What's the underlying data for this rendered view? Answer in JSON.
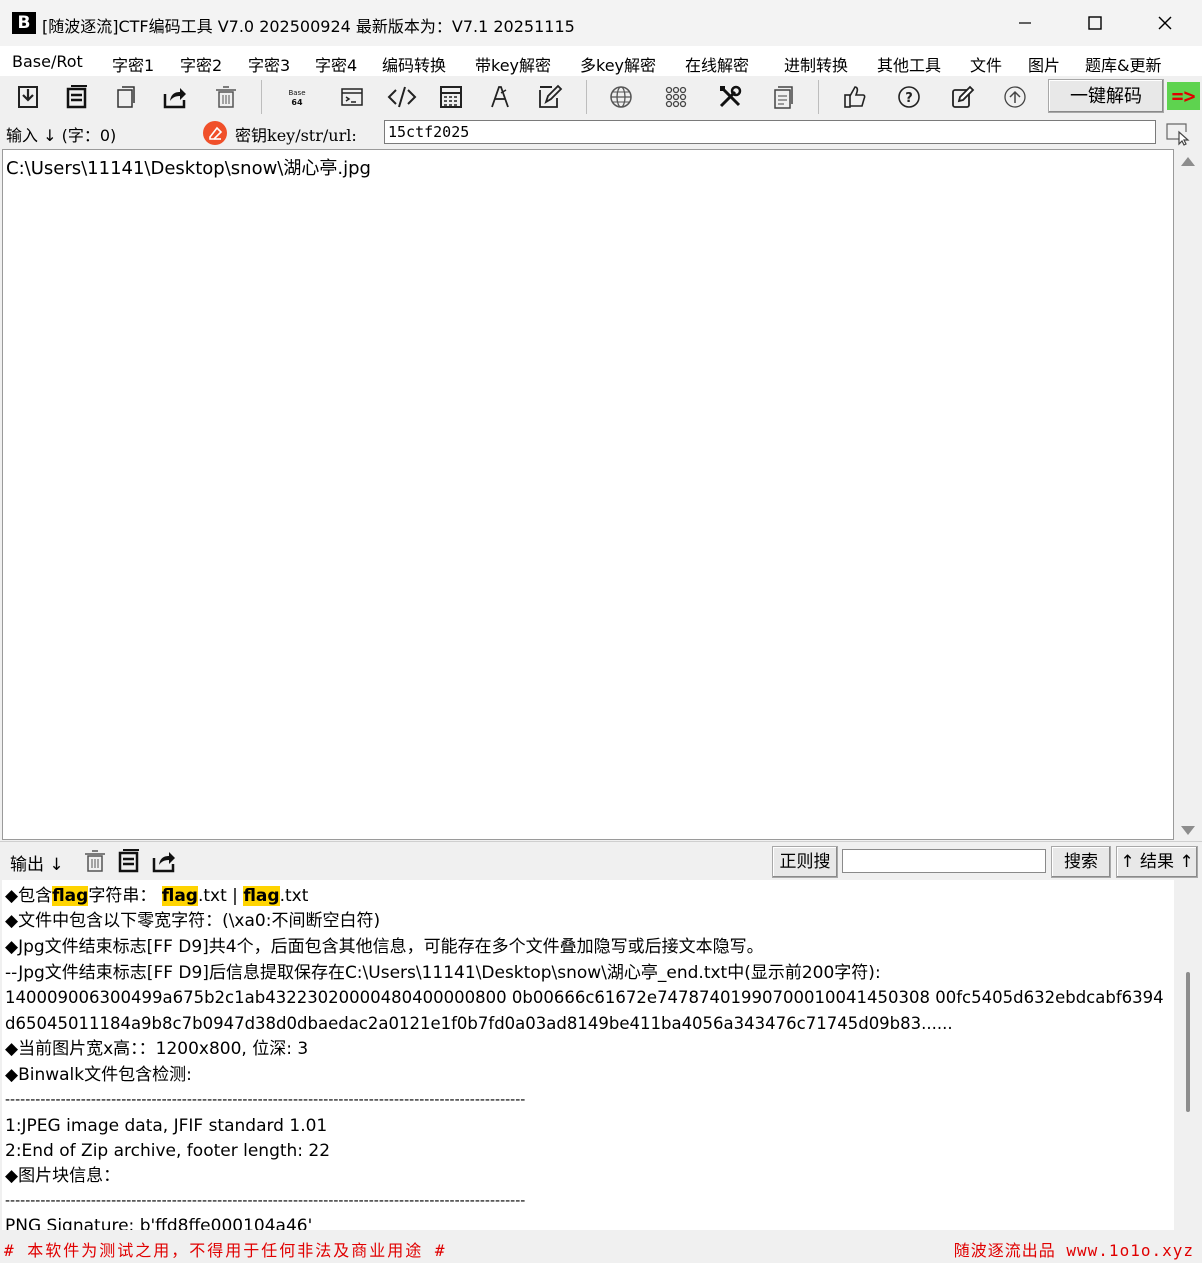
{
  "window": {
    "logo_text": "B",
    "title": "[随波逐流]CTF编码工具 V7.0 202500924    最新版本为：V7.1  20251115"
  },
  "menu": [
    {
      "label": "Base/Rot"
    },
    {
      "label": "字密1"
    },
    {
      "label": "字密2"
    },
    {
      "label": "字密3"
    },
    {
      "label": "字密4"
    },
    {
      "label": "编码转换"
    },
    {
      "label": "带key解密"
    },
    {
      "label": "多key解密"
    },
    {
      "label": "在线解密"
    },
    {
      "label": "进制转换"
    },
    {
      "label": "其他工具"
    },
    {
      "label": "文件"
    },
    {
      "label": "图片"
    },
    {
      "label": "题库&更新"
    }
  ],
  "toolbar": {
    "icons": [
      "import-icon",
      "copy-icon",
      "paste-icon",
      "share-icon",
      "trash-icon",
      "base64-icon",
      "terminal-icon",
      "code-icon",
      "calculator-icon",
      "font-icon",
      "edit-frame-icon",
      "globe-icon",
      "grid-icon",
      "tools-icon",
      "document-icon",
      "thumbs-up-icon",
      "help-icon",
      "pencil-icon",
      "upload-icon"
    ],
    "base64_glyph": "Base\n64",
    "decode_all_label": "一键解码",
    "arrow_label": "=>"
  },
  "input": {
    "label": "输入 ↓ (字：0)",
    "key_label": "密钥key/str/url:",
    "key_value": "15ctf2025",
    "text": "C:\\Users\\11141\\Desktop\\snow\\湖心亭.jpg"
  },
  "output": {
    "label": "输出 ↓",
    "regex_search_label": "正则搜",
    "search_value": "",
    "search_button_label": "搜索",
    "result_button_label": "↑ 结果 ↑",
    "lines": {
      "l1_prefix": "◆包含",
      "l1_hl1": "flag",
      "l1_mid": "字符串：  ",
      "l1_hl2": "flag",
      "l1_txt1": ".txt | ",
      "l1_hl3": "flag",
      "l1_txt2": ".txt",
      "l2": "◆文件中包含以下零宽字符：(\\xa0:不间断空白符)",
      "l3": "◆Jpg文件结束标志[FF D9]共4个，后面包含其他信息，可能存在多个文件叠加隐写或后接文本隐写。",
      "l4": "--Jpg文件结束标志[FF D9]后信息提取保存在C:\\Users\\11141\\Desktop\\snow\\湖心亭_end.txt中(显示前200字符):",
      "l5": "140009006300499a675b2c1ab43223020000480400000800 0b00666c61672e74787401990700010041450308 00fc5405d632ebdcabf6394",
      "l6": "d65045011184a9b8c7b0947d38d0dbaedac2a0121e1f0b7fd0a03ad8149be411ba4056a343476c71745d09b83......",
      "l7": "◆当前图片宽x高：：1200x800, 位深: 3",
      "l8": "◆Binwalk文件包含检测:",
      "l9": "-------------------------------------------------------------------------------------------------------",
      "l10": "1:JPEG image data, JFIF standard 1.01",
      "l11": "2:End of Zip archive, footer length: 22",
      "l12": "◆图片块信息：",
      "l13": "-------------------------------------------------------------------------------------------------------",
      "l14": "PNG Signature: b'ffd8ffe000104a46'"
    }
  },
  "status": {
    "left": "# 本软件为测试之用，不得用于任何非法及商业用途 #",
    "right": "随波逐流出品 www.1o1o.xyz"
  },
  "colors": {
    "accent_red": "#e00000",
    "highlight_yellow": "#ffd400",
    "arrow_bg_green": "#5ed34f",
    "key_icon_orange": "#f0502a"
  }
}
